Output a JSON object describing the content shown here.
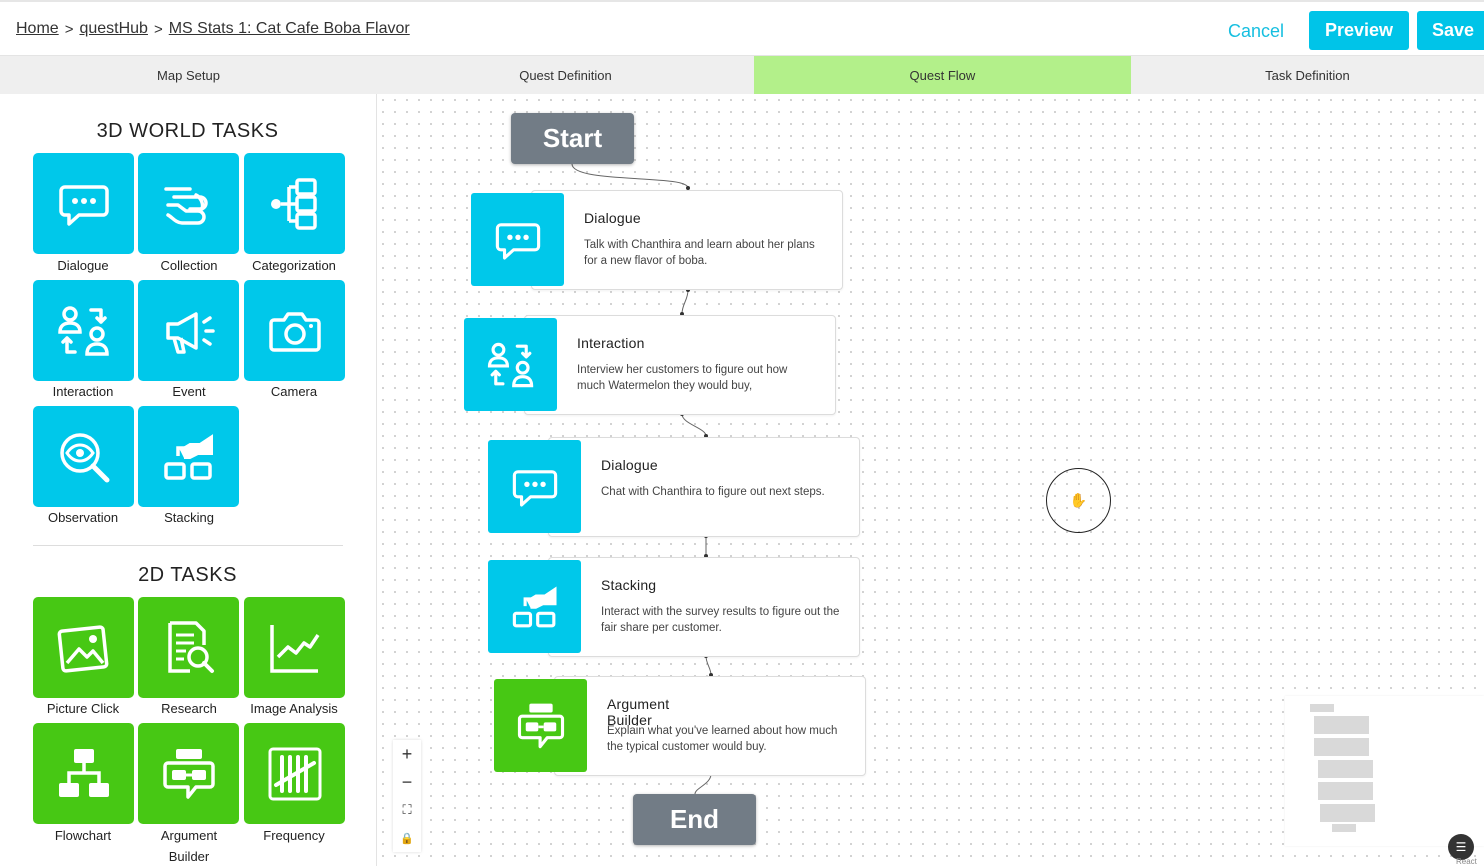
{
  "breadcrumb": {
    "home": "Home",
    "hub": "questHub",
    "quest": "MS Stats 1: Cat Cafe Boba Flavor",
    "separator": ">"
  },
  "header": {
    "cancel": "Cancel",
    "preview": "Preview",
    "save": "Save",
    "accent": "#00c4e8"
  },
  "tabs": [
    {
      "label": "Map Setup"
    },
    {
      "label": "Quest Definition"
    },
    {
      "label": "Quest Flow",
      "active": true
    },
    {
      "label": "Task Definition"
    }
  ],
  "sidebar": {
    "world_title": "3D WORLD TASKS",
    "world_tasks": [
      {
        "label": "Dialogue",
        "icon": "chat-bubble-icon"
      },
      {
        "label": "Collection",
        "icon": "hand-collect-icon"
      },
      {
        "label": "Categorization",
        "icon": "tree-branch-icon"
      },
      {
        "label": "Interaction",
        "icon": "people-swap-icon"
      },
      {
        "label": "Event",
        "icon": "megaphone-icon"
      },
      {
        "label": "Camera",
        "icon": "camera-icon"
      },
      {
        "label": "Observation",
        "icon": "eye-magnifier-icon"
      },
      {
        "label": "Stacking",
        "icon": "stacking-hand-icon"
      }
    ],
    "flat_title": "2D TASKS",
    "flat_tasks": [
      {
        "label": "Picture Click",
        "icon": "picture-icon"
      },
      {
        "label": "Research",
        "icon": "document-search-icon"
      },
      {
        "label": "Image Analysis",
        "icon": "line-chart-icon"
      },
      {
        "label": "Flowchart",
        "icon": "flowchart-icon"
      },
      {
        "label": "Argument Builder",
        "icon": "argument-builder-icon"
      },
      {
        "label": "Frequency",
        "icon": "tally-marks-icon"
      }
    ],
    "colors": {
      "world": "#00c8ea",
      "flat": "#47c814"
    }
  },
  "flow": {
    "start": "Start",
    "end": "End",
    "nodes": [
      {
        "title": "Dialogue",
        "description": "Talk with Chanthira and learn about her plans for a new flavor of boba.",
        "icon": "chat-bubble-icon"
      },
      {
        "title": "Interaction",
        "description": "Interview her customers to figure out how much Watermelon they would buy,",
        "icon": "people-swap-icon"
      },
      {
        "title": "Dialogue",
        "description": "Chat with Chanthira to figure out next steps.",
        "icon": "chat-bubble-icon"
      },
      {
        "title": "Stacking",
        "description": "Interact with the survey results to figure out the fair share per customer.",
        "icon": "stacking-hand-icon"
      },
      {
        "title": "Argument Builder",
        "description": "Explain what you've learned about how much the typical customer would buy.",
        "icon": "argument-builder-icon"
      }
    ]
  },
  "zoom_controls": {
    "zoom_in": "+",
    "zoom_out": "−",
    "fit": "⛶",
    "lock": "🔒"
  },
  "corner_text": "React"
}
